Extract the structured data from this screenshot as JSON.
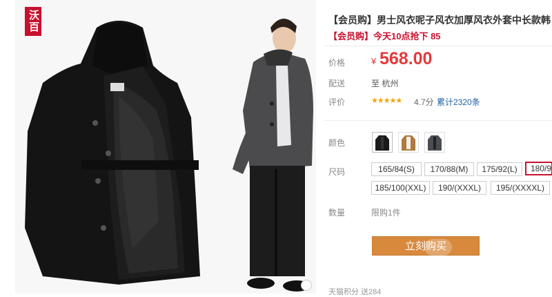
{
  "logo": {
    "text": "沃百"
  },
  "product": {
    "title_tag": "【会员购】",
    "title_text": "男士风衣呢子风衣加厚风衣外套中长款韩",
    "subtitle": "【会员购】今天10点抢下 85"
  },
  "price": {
    "label": "价格",
    "currency": "¥",
    "value": "568.00"
  },
  "shipping": {
    "label": "配送",
    "value": "至 杭州"
  },
  "rating": {
    "label": "评价",
    "stars": "★★★★★",
    "score": "4.7分",
    "count": "累计2320条"
  },
  "colors": {
    "label": "颜色",
    "swatches": [
      {
        "name": "black",
        "color": "#1a1a1a",
        "lining": "#2a2a2a"
      },
      {
        "name": "khaki",
        "color": "#b07a3e",
        "lining": "#f2efe6"
      },
      {
        "name": "grey",
        "color": "#4a4d52",
        "lining": "#222"
      }
    ]
  },
  "sizes": {
    "label": "尺码",
    "options": [
      "165/84(S)",
      "170/88(M)",
      "175/92(L)",
      "180/9",
      "185/100(XXL)",
      "190/(XXXL)",
      "195/(XXXXL)"
    ],
    "selected": "180/9"
  },
  "quantity": {
    "label": "数量",
    "limit": "限购1件"
  },
  "buy_button": {
    "label": "立刻购买"
  },
  "bottom_partial": {
    "text": "天猫积分  送284"
  },
  "accent_colors": {
    "price": "#e4393c",
    "brand": "#c8102e",
    "buy": "#d8893c"
  }
}
